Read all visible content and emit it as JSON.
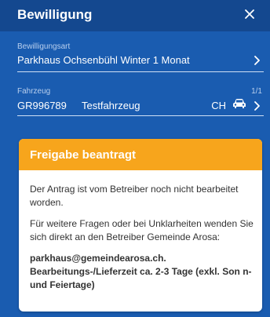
{
  "header": {
    "title": "Bewilligung",
    "close_icon": "close-icon"
  },
  "permit": {
    "label": "Bewilligungsart",
    "value": "Parkhaus Ochsenbühl Winter 1 Monat"
  },
  "vehicle": {
    "label": "Fahrzeug",
    "count": "1/1",
    "plate": "GR996789",
    "name": "Testfahrzeug",
    "country": "CH",
    "icon": "car-icon"
  },
  "status": {
    "title": "Freigabe beantragt",
    "accent_color": "#f7a51c",
    "paragraph1": "Der Antrag ist vom Betreiber noch nicht bearbeitet worden.",
    "paragraph2": "Für weitere Fragen oder bei Unklarheiten wenden Sie sich direkt an den Betreiber Gemeinde Arosa:",
    "email": "parkhaus@gemeindearosa.ch.",
    "processing": "Bearbeitungs-/Lieferzeit ca. 2-3 Tage (exkl. Son n-und Feiertage)"
  },
  "colors": {
    "background": "#1a5cb0",
    "header": "#14488f"
  }
}
